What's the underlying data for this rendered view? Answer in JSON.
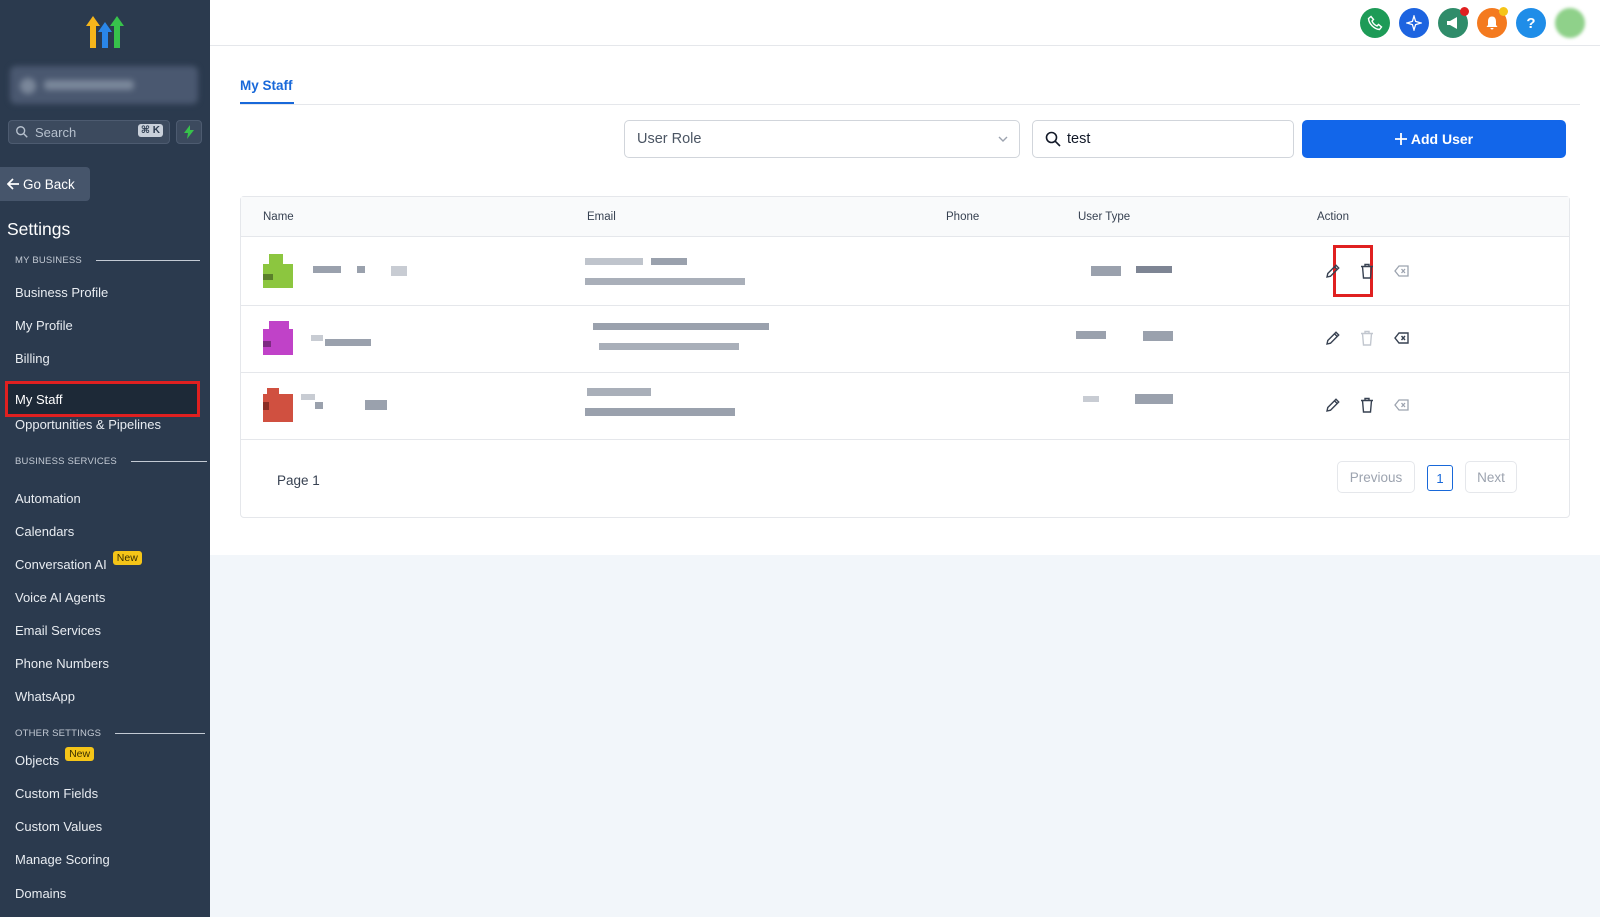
{
  "sidebar": {
    "search_placeholder": "Search",
    "search_shortcut": "⌘ K",
    "go_back": "Go Back",
    "settings_title": "Settings",
    "section_my_business": "MY BUSINESS",
    "section_business_services": "BUSINESS SERVICES",
    "section_other_settings": "OTHER SETTINGS",
    "badge_new": "New",
    "items": {
      "business_profile": "Business Profile",
      "my_profile": "My Profile",
      "billing": "Billing",
      "my_staff": "My Staff",
      "opportunities": "Opportunities & Pipelines",
      "automation": "Automation",
      "calendars": "Calendars",
      "conversation_ai": "Conversation AI",
      "voice_ai": "Voice AI Agents",
      "email_services": "Email Services",
      "phone_numbers": "Phone Numbers",
      "whatsapp": "WhatsApp",
      "objects": "Objects",
      "custom_fields": "Custom Fields",
      "custom_values": "Custom Values",
      "manage_scoring": "Manage Scoring",
      "domains": "Domains"
    }
  },
  "topbar": {
    "icons": [
      "phone-icon",
      "sparkle-icon",
      "megaphone-icon",
      "bell-icon",
      "help-icon",
      "user-avatar"
    ],
    "help_label": "?"
  },
  "main": {
    "tab": "My Staff",
    "user_role_placeholder": "User Role",
    "search_value": "test",
    "add_user": "Add User",
    "columns": {
      "name": "Name",
      "email": "Email",
      "phone": "Phone",
      "user_type": "User Type",
      "action": "Action"
    },
    "page_label": "Page 1",
    "previous": "Previous",
    "current_page": "1",
    "next": "Next"
  },
  "colors": {
    "sidebar_bg": "#2b3a4e",
    "accent_blue": "#1266ea",
    "highlight_red": "#e02020",
    "avatar_1": "#8cc63f",
    "avatar_2": "#c042c8",
    "avatar_3": "#d05040"
  }
}
